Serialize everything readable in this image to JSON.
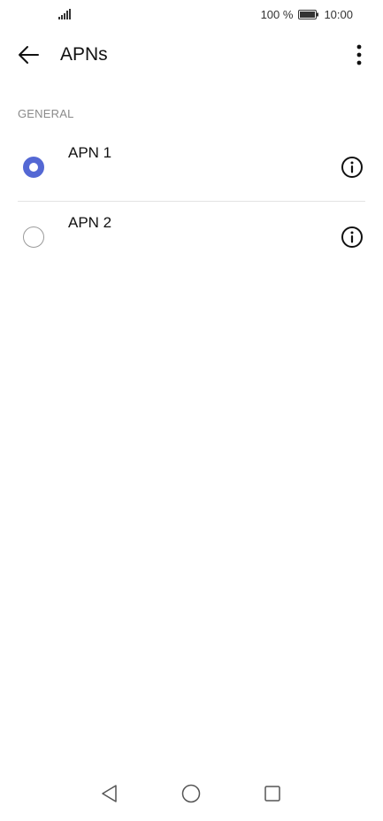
{
  "status_bar": {
    "signal_icon": "signal-icon",
    "battery_percent": "100 %",
    "battery_icon": "battery-icon",
    "time": "10:00"
  },
  "header": {
    "back_icon": "arrow-left-icon",
    "title": "APNs",
    "more_icon": "more-vertical-icon"
  },
  "section": {
    "label": "GENERAL"
  },
  "apns": [
    {
      "name": "APN 1",
      "selected": true,
      "info_icon": "info-icon"
    },
    {
      "name": "APN 2",
      "selected": false,
      "info_icon": "info-icon"
    }
  ],
  "nav_bar": {
    "back_icon": "triangle-back-icon",
    "home_icon": "circle-home-icon",
    "recent_icon": "square-recent-icon"
  },
  "colors": {
    "accent": "#5468d4",
    "section_text": "#8a8a8a",
    "divider": "#e3e3e3"
  }
}
